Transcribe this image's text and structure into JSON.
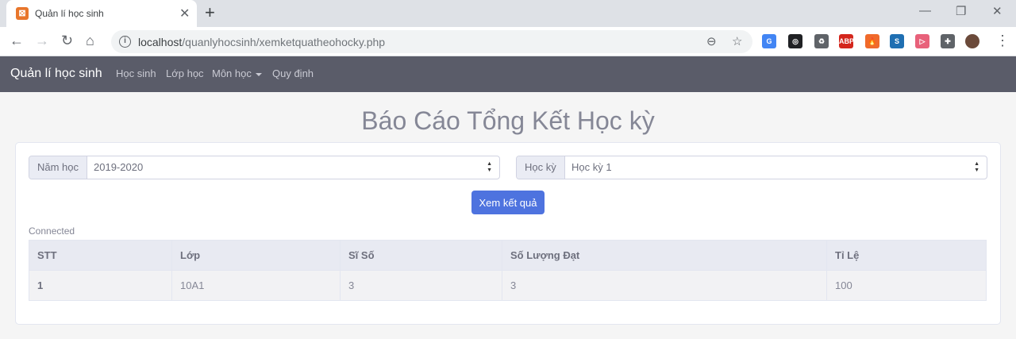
{
  "browser": {
    "tab_title": "Quản lí học sinh",
    "favicon_glyph": "☒",
    "url_host": "localhost",
    "url_path": "/quanlyhocsinh/xemketquatheohocky.php",
    "extensions": [
      {
        "name": "google-translate-icon",
        "label": "G",
        "color": "#4285f4"
      },
      {
        "name": "eye-off-icon",
        "label": "◎",
        "color": "#202124"
      },
      {
        "name": "recycle-icon",
        "label": "♻",
        "color": "#5f6368"
      },
      {
        "name": "adblock-plus-icon",
        "label": "ABP",
        "color": "#d4261c"
      },
      {
        "name": "fire-icon",
        "label": "🔥",
        "color": "#f06a2b"
      },
      {
        "name": "s-extension-icon",
        "label": "S",
        "color": "#1f6fb2"
      },
      {
        "name": "share-icon",
        "label": "▷",
        "color": "#e8617a"
      },
      {
        "name": "puzzle-icon",
        "label": "✚",
        "color": "#5f6368"
      }
    ]
  },
  "navbar": {
    "brand": "Quản lí học sinh",
    "links": [
      "Học sinh",
      "Lớp học",
      "Môn học",
      "Quy định"
    ]
  },
  "page": {
    "title": "Báo Cáo Tổng Kết Học kỳ"
  },
  "form": {
    "year_label": "Năm học",
    "year_value": "2019-2020",
    "term_label": "Học kỳ",
    "term_value": "Học kỳ 1",
    "submit_label": "Xem kết quả"
  },
  "status_text": "Connected",
  "table": {
    "headers": [
      "STT",
      "Lớp",
      "Sĩ Số",
      "Số Lượng Đạt",
      "Tỉ Lệ"
    ],
    "rows": [
      [
        "1",
        "10A1",
        "3",
        "3",
        "100"
      ]
    ]
  }
}
